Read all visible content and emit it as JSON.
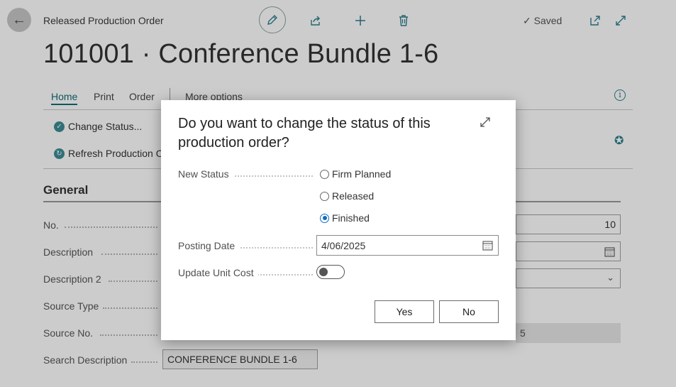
{
  "header": {
    "breadcrumb": "Released Production Order",
    "saved_label": "Saved",
    "title": "101001 · Conference Bundle 1-6"
  },
  "menu": {
    "home": "Home",
    "print": "Print",
    "order": "Order",
    "more": "More options"
  },
  "actions": {
    "change_status": "Change Status...",
    "refresh": "Refresh Production O"
  },
  "general": {
    "section_title": "General",
    "fields": {
      "no": "No.",
      "description": "Description",
      "description2": "Description 2",
      "source_type": "Source Type",
      "source_no": "Source No.",
      "search_description": "Search Description"
    },
    "search_description_value": "CONFERENCE BUNDLE 1-6",
    "right_value_1": "10",
    "right_value_partial": "5"
  },
  "dialog": {
    "title": "Do you want to change the status of this production order?",
    "new_status_label": "New Status",
    "options": {
      "firm_planned": "Firm Planned",
      "released": "Released",
      "finished": "Finished"
    },
    "selected_option": "Finished",
    "posting_date_label": "Posting Date",
    "posting_date_value": "4/06/2025",
    "update_unit_cost_label": "Update Unit Cost",
    "update_unit_cost_on": false,
    "yes": "Yes",
    "no": "No"
  },
  "colors": {
    "accent": "#0f6e7a",
    "radio_selected": "#0f6cbd"
  }
}
